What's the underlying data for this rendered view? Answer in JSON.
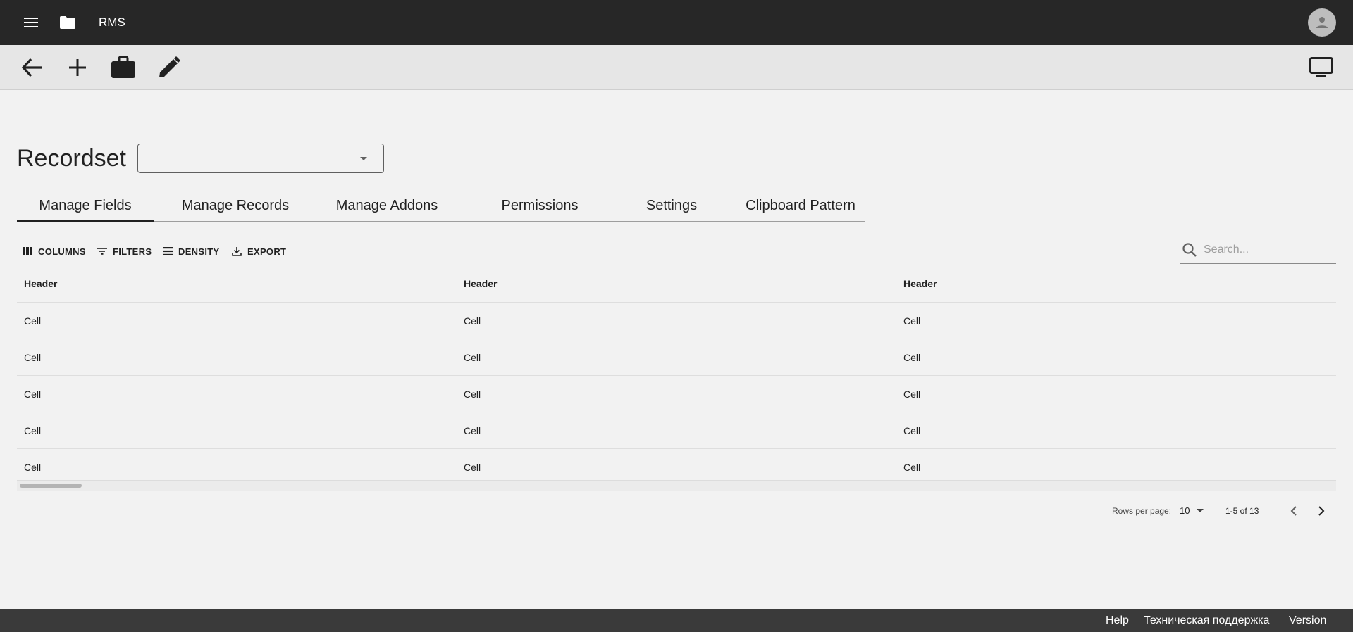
{
  "app": {
    "title": "RMS",
    "menu_icon": "menu-icon",
    "folder_icon": "folder-icon",
    "avatar_icon": "person-icon"
  },
  "toolbar": {
    "items": [
      {
        "icon": "arrow-back-icon"
      },
      {
        "icon": "add-icon"
      },
      {
        "icon": "briefcase-icon"
      },
      {
        "icon": "edit-icon"
      }
    ],
    "right_icon": "monitor-icon"
  },
  "page": {
    "title": "Recordset",
    "recordset_select_value": ""
  },
  "tabs": [
    {
      "label": "Manage Fields",
      "active": true
    },
    {
      "label": "Manage Records",
      "active": false
    },
    {
      "label": "Manage Addons",
      "active": false
    },
    {
      "label": "Permissions",
      "active": false
    },
    {
      "label": "Settings",
      "active": false
    },
    {
      "label": "Clipboard Pattern",
      "active": false
    }
  ],
  "grid_toolbar": {
    "columns_label": "COLUMNS",
    "filters_label": "FILTERS",
    "density_label": "DENSITY",
    "export_label": "EXPORT",
    "search_placeholder": "Search..."
  },
  "table": {
    "headers": [
      "Header",
      "Header",
      "Header"
    ],
    "rows": [
      [
        "Cell",
        "Cell",
        "Cell"
      ],
      [
        "Cell",
        "Cell",
        "Cell"
      ],
      [
        "Cell",
        "Cell",
        "Cell"
      ],
      [
        "Cell",
        "Cell",
        "Cell"
      ],
      [
        "Cell",
        "Cell",
        "Cell"
      ]
    ]
  },
  "pagination": {
    "rows_per_page_label": "Rows per page:",
    "rows_per_page_value": "10",
    "range_label": "1-5 of 13"
  },
  "footer": {
    "help": "Help",
    "support": "Техническая поддержка",
    "version": "Version"
  },
  "colors": {
    "appbar_bg": "#272727",
    "toolbar_bg": "#e6e6e6",
    "page_bg": "#f2f2f2",
    "footer_bg": "#3a3a3a"
  }
}
